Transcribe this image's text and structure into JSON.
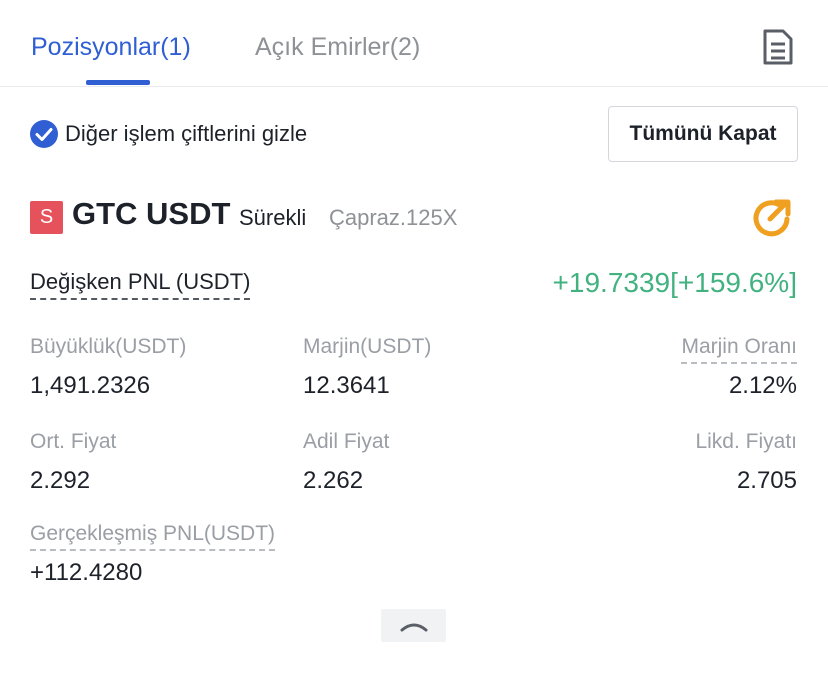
{
  "tabs": [
    {
      "label": "Pozisyonlar(1)",
      "active": true
    },
    {
      "label": "Açık Emirler(2)",
      "active": false
    }
  ],
  "hide_other_pairs": {
    "label": "Diğer işlem çiftlerini gizle",
    "checked": true
  },
  "close_all_button": "Tümünü Kapat",
  "position": {
    "side_badge": "S",
    "symbol": "GTC USDT",
    "contract_type": "Sürekli",
    "margin_mode": "Çapraz.125X",
    "unrealized_pnl_label": "Değişken PNL (USDT)",
    "unrealized_pnl_value": "+19.7339[+159.6%]",
    "stats": {
      "size_label": "Büyüklük(USDT)",
      "size_value": "1,491.2326",
      "margin_label": "Marjin(USDT)",
      "margin_value": "12.3641",
      "margin_ratio_label": "Marjin Oranı",
      "margin_ratio_value": "2.12%",
      "avg_price_label": "Ort. Fiyat",
      "avg_price_value": "2.292",
      "mark_price_label": "Adil Fiyat",
      "mark_price_value": "2.262",
      "liq_price_label": "Likd. Fiyatı",
      "liq_price_value": "2.705",
      "realized_pnl_label": "Gerçekleşmiş PNL(USDT)",
      "realized_pnl_value": "+112.4280"
    }
  },
  "icons": {
    "document": "document-icon",
    "check": "check-circle-icon",
    "share": "share-icon",
    "collapse": "chevron-up-icon"
  },
  "colors": {
    "accent": "#2f5fd3",
    "sell": "#e5525b",
    "profit": "#42b280",
    "share_orange": "#f0a020"
  }
}
